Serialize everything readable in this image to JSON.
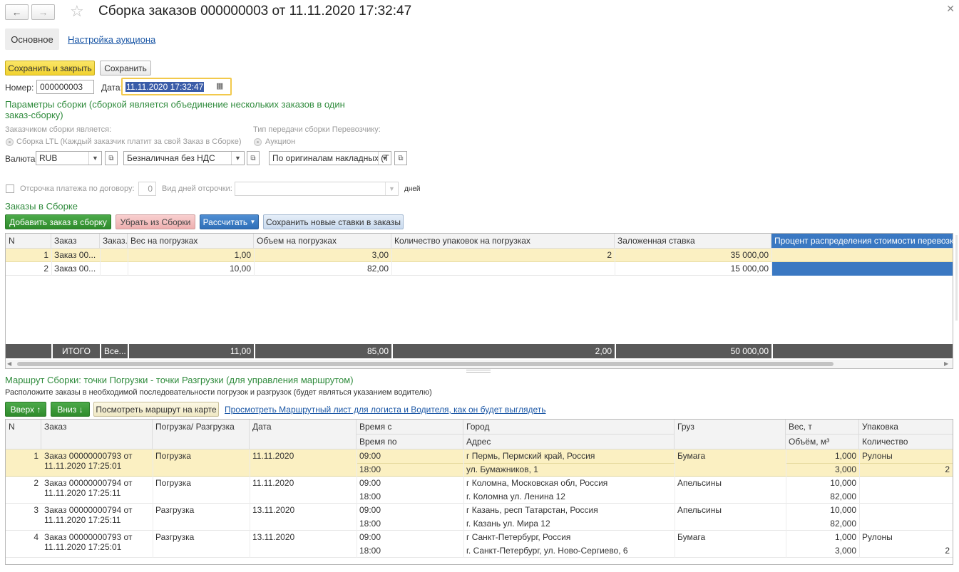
{
  "window": {
    "title": "Сборка заказов 000000003 от 11.11.2020 17:32:47",
    "back_icon": "arrow-left-icon",
    "forward_icon": "arrow-right-icon",
    "star_icon": "star-icon",
    "close_icon": "close-icon"
  },
  "tabs": {
    "main": "Основное",
    "auction": "Настройка аукциона"
  },
  "toolbar": {
    "save_close": "Сохранить и закрыть",
    "save": "Сохранить"
  },
  "header": {
    "number_label": "Номер:",
    "number_value": "000000003",
    "date_label": "Дата:",
    "date_value": "11.11.2020 17:32:47"
  },
  "params": {
    "title": "Параметры сборки (сборкой является объединение нескольких заказов в один заказ-сборку)",
    "customer_label": "Заказчиком сборки является:",
    "customer_option": "Сборка LTL (Каждый заказчик платит за свой Заказ в Сборке)",
    "transfer_label": "Тип передачи сборки Перевозчику:",
    "transfer_option": "Аукцион",
    "currency_label": "Валюта:",
    "currency_value": "RUB",
    "payment_value": "Безналичная без НДС",
    "docs_value": "По оригиналам накладных (Т",
    "deferral_label": "Отсрочка платежа по договору:",
    "deferral_value": "0",
    "days_type_label": "Вид дней отсрочки:",
    "days_label": "дней"
  },
  "orders": {
    "title": "Заказы в Сборке",
    "btn_add": "Добавить заказ в сборку",
    "btn_remove": "Убрать из Сборки",
    "btn_calc": "Рассчитать",
    "btn_save_rates": "Сохранить новые ставки в заказы",
    "columns": [
      "N",
      "Заказ",
      "Заказ...",
      "Вес на погрузках",
      "Объем на погрузках",
      "Количество упаковок на погрузках",
      "Заложенная ставка",
      "Процент распределения стоимости перевозки"
    ],
    "rows": [
      {
        "n": "1",
        "order": "Заказ 00...",
        "c3": "",
        "weight": "1,00",
        "volume": "3,00",
        "packs": "2",
        "rate": "35 000,00",
        "percent": ""
      },
      {
        "n": "2",
        "order": "Заказ 00...",
        "c3": "",
        "weight": "10,00",
        "volume": "82,00",
        "packs": "",
        "rate": "15 000,00",
        "percent": ""
      }
    ],
    "totals": {
      "label": "ИТОГО",
      "c3": "Все...",
      "weight": "11,00",
      "volume": "85,00",
      "packs": "2,00",
      "rate": "50 000,00"
    }
  },
  "route": {
    "title": "Маршрут Сборки: точки Погрузки - точки Разгрузки (для управления маршрутом)",
    "hint": "Расположите заказы в необходимой последовательности погрузок и разгрузок (будет являться указанием водителю)",
    "btn_up": "Вверх ↑",
    "btn_down": "Вниз ↓",
    "btn_map": "Посмотреть маршрут на карте",
    "link_sheet": "Просмотреть Маршрутный лист для логиста и Водителя, как он будет выглядеть",
    "columns": {
      "n": "N",
      "order": "Заказ",
      "type": "Погрузка/ Разгрузка",
      "date": "Дата",
      "time_from": "Время с",
      "time_to": "Время по",
      "city": "Город",
      "address": "Адрес",
      "cargo": "Груз",
      "weight": "Вес, т",
      "volume": "Объём, м³",
      "packing": "Упаковка",
      "qty": "Количество"
    },
    "rows": [
      {
        "n": "1",
        "order1": "Заказ 00000000793 от",
        "order2": "11.11.2020 17:25:01",
        "type": "Погрузка",
        "date": "11.11.2020",
        "time_from": "09:00",
        "time_to": "18:00",
        "city": "г Пермь,  Пермский край, Россия",
        "address": "ул. Бумажников, 1",
        "cargo": "Бумага",
        "weight": "1,000",
        "volume": "3,000",
        "packing": "Рулоны",
        "qty": "2"
      },
      {
        "n": "2",
        "order1": "Заказ 00000000794 от",
        "order2": "11.11.2020 17:25:11",
        "type": "Погрузка",
        "date": "11.11.2020",
        "time_from": "09:00",
        "time_to": "18:00",
        "city": "г Коломна,  Московская обл, Россия",
        "address": "г. Коломна ул. Ленина 12",
        "cargo": "Апельсины",
        "weight": "10,000",
        "volume": "82,000",
        "packing": "",
        "qty": ""
      },
      {
        "n": "3",
        "order1": "Заказ 00000000794 от",
        "order2": "11.11.2020 17:25:11",
        "type": "Разгрузка",
        "date": "13.11.2020",
        "time_from": "09:00",
        "time_to": "18:00",
        "city": "г Казань,  респ Татарстан, Россия",
        "address": "г. Казань ул. Мира 12",
        "cargo": "Апельсины",
        "weight": "10,000",
        "volume": "82,000",
        "packing": "",
        "qty": ""
      },
      {
        "n": "4",
        "order1": "Заказ 00000000793 от",
        "order2": "11.11.2020 17:25:01",
        "type": "Разгрузка",
        "date": "13.11.2020",
        "time_from": "09:00",
        "time_to": "18:00",
        "city": "г Санкт-Петербург, Россия",
        "address": "г. Санкт-Петербург, ул. Ново-Сергиево, 6",
        "cargo": "Бумага",
        "weight": "1,000",
        "volume": "3,000",
        "packing": "Рулоны",
        "qty": "2"
      }
    ]
  },
  "colors": {
    "accent_green": "#2f8b3c",
    "selected_row": "#fbf0c2",
    "highlight_blue": "#3a78c2"
  }
}
